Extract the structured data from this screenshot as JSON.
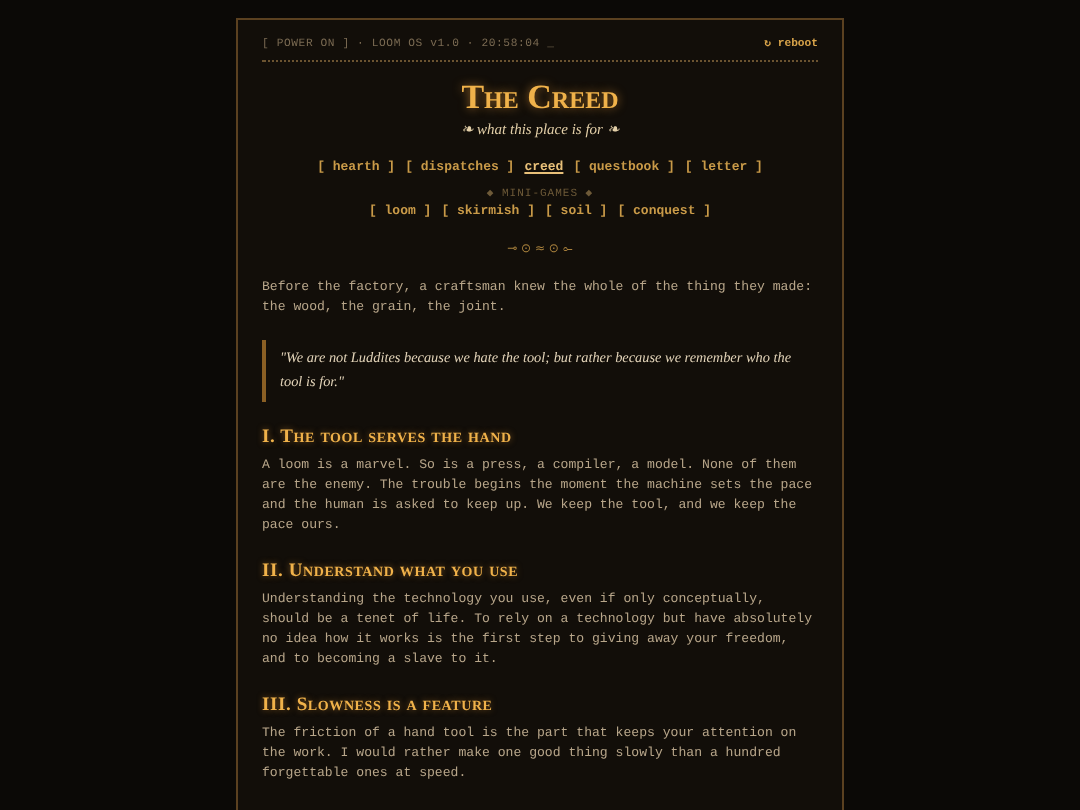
{
  "status_bar": {
    "text": "[ POWER ON ] · LOOM OS v1.0 · 20:58:04 _",
    "reboot": "↻ reboot"
  },
  "header": {
    "title": "The Creed",
    "subtitle": "❧ what this place is for ❧"
  },
  "nav": [
    {
      "label": "[ hearth ]",
      "selected": false
    },
    {
      "label": "[ dispatches ]",
      "selected": false
    },
    {
      "label": "creed",
      "selected": true
    },
    {
      "label": "[ questbook ]",
      "selected": false
    },
    {
      "label": "[ letter ]",
      "selected": false
    }
  ],
  "mini_games": {
    "heading": "◆ MINI-GAMES ◆",
    "items": [
      {
        "label": "[ loom ]",
        "selected": false
      },
      {
        "label": "[ skirmish ]",
        "selected": false
      },
      {
        "label": "[ soil ]",
        "selected": false
      },
      {
        "label": "[ conquest ]",
        "selected": false
      }
    ]
  },
  "ornament": "⊸ ⊙ ≈ ⊙ ⟜",
  "intro": "Before the factory, a craftsman knew the whole of the thing they made: the wood, the grain, the joint.",
  "quote": "\"We are not Luddites because we hate the tool; but rather because we remember who the tool is for.\"",
  "sections": [
    {
      "heading": "I. The tool serves the hand",
      "body": "A loom is a marvel. So is a press, a compiler, a model. None of them are the enemy. The trouble begins the moment the machine sets the pace and the human is asked to keep up. We keep the tool, and we keep the pace ours."
    },
    {
      "heading": "II. Understand what you use",
      "body": "Understanding the technology you use, even if only conceptually, should be a tenet of life. To rely on a technology but have absolutely no idea how it works is the first step to giving away your freedom, and to becoming a slave to it."
    },
    {
      "heading": "III. Slowness is a feature",
      "body": "The friction of a hand tool is the part that keeps your attention on the work. I would rather make one good thing slowly than a hundred forgettable ones at speed."
    }
  ]
}
